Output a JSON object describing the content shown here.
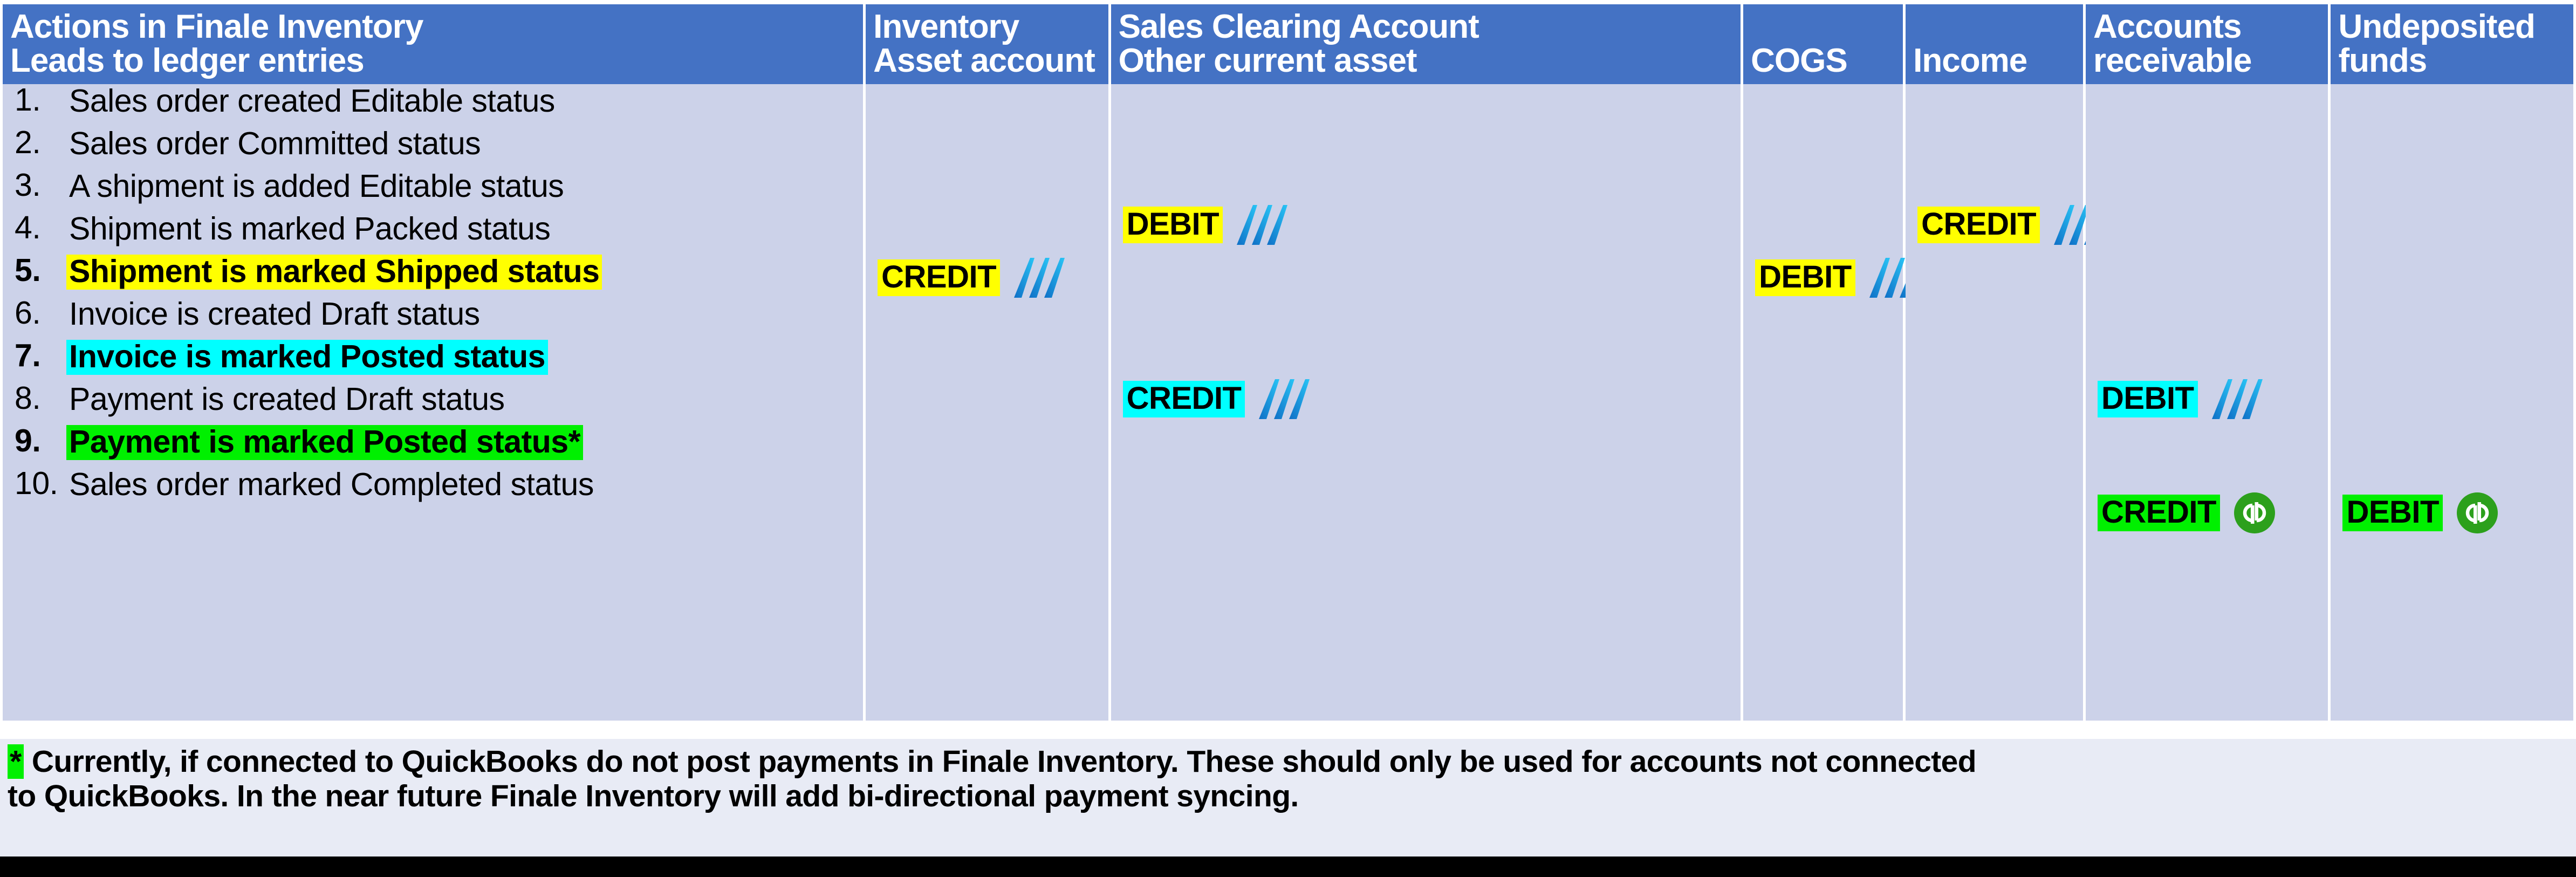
{
  "table": {
    "columns": [
      {
        "id": "actions",
        "line1": "Actions in Finale Inventory",
        "line2": "Leads to ledger entries"
      },
      {
        "id": "inventory",
        "line1": "Inventory",
        "line2": "Asset account"
      },
      {
        "id": "sales_clearing",
        "line1": "Sales Clearing Account",
        "line2": "Other current asset"
      },
      {
        "id": "cogs",
        "line1": "COGS",
        "line2": ""
      },
      {
        "id": "income",
        "line1": "Income",
        "line2": ""
      },
      {
        "id": "accounts_receivable",
        "line1": "Accounts",
        "line2": "receivable"
      },
      {
        "id": "undeposited_funds",
        "line1": "Undeposited",
        "line2": "funds"
      }
    ],
    "actions": [
      {
        "num": "1.",
        "text": "Sales order created Editable status",
        "highlight": "none",
        "bold": false
      },
      {
        "num": "2.",
        "text": "Sales order Committed status",
        "highlight": "none",
        "bold": false
      },
      {
        "num": "3.",
        "text": "A shipment is added Editable status",
        "highlight": "none",
        "bold": false
      },
      {
        "num": "4.",
        "text": "Shipment is marked Packed status",
        "highlight": "none",
        "bold": false
      },
      {
        "num": "5.",
        "text": "Shipment is marked Shipped status",
        "highlight": "yellow",
        "bold": true
      },
      {
        "num": "6.",
        "text": "Invoice is created Draft status",
        "highlight": "none",
        "bold": false
      },
      {
        "num": "7.",
        "text": "Invoice is marked Posted status",
        "highlight": "cyan",
        "bold": true
      },
      {
        "num": "8.",
        "text": "Payment is created Draft status",
        "highlight": "none",
        "bold": false
      },
      {
        "num": "9.",
        "text": "Payment is marked Posted status*",
        "highlight": "green",
        "bold": true
      },
      {
        "num": "10.",
        "text": "Sales order marked Completed status",
        "highlight": "none",
        "bold": false
      }
    ],
    "entries": {
      "inventory": [
        {
          "label": "CREDIT",
          "highlight": "yellow",
          "icon": "finale-logo-icon",
          "slot": "b"
        }
      ],
      "sales_clearing": [
        {
          "label": "DEBIT",
          "highlight": "yellow",
          "icon": "finale-logo-icon",
          "slot": "a"
        },
        {
          "label": "CREDIT",
          "highlight": "cyan",
          "icon": "finale-logo-icon",
          "slot": "c"
        }
      ],
      "cogs": [
        {
          "label": "DEBIT",
          "highlight": "yellow",
          "icon": "finale-logo-icon",
          "slot": "b"
        }
      ],
      "income": [
        {
          "label": "CREDIT",
          "highlight": "yellow",
          "icon": "finale-logo-icon",
          "slot": "a"
        }
      ],
      "accounts_receivable": [
        {
          "label": "DEBIT",
          "highlight": "cyan",
          "icon": "finale-logo-icon",
          "slot": "c"
        },
        {
          "label": "CREDIT",
          "highlight": "green",
          "icon": "quickbooks-icon",
          "slot": "d"
        }
      ],
      "undeposited_funds": [
        {
          "label": "DEBIT",
          "highlight": "green",
          "icon": "quickbooks-icon",
          "slot": "d"
        }
      ]
    }
  },
  "footnote": {
    "marker": "*",
    "line1": "Currently, if connected to QuickBooks do not post payments in Finale Inventory. These should only be used for accounts not connected",
    "line2": "to QuickBooks. In the near future Finale Inventory will add bi-directional payment syncing."
  },
  "colors": {
    "header_blue": "#4472C4",
    "body_lavender": "#CCD2E9",
    "footer_background": "#E8EBF5",
    "highlight_yellow": "#FFFF00",
    "highlight_cyan": "#00FFFF",
    "highlight_green": "#00F000",
    "finale_blue_dark": "#0F6FC6",
    "finale_blue_light": "#29C5F6",
    "quickbooks_green": "#2CA01C",
    "bottom_bar": "#000000"
  }
}
